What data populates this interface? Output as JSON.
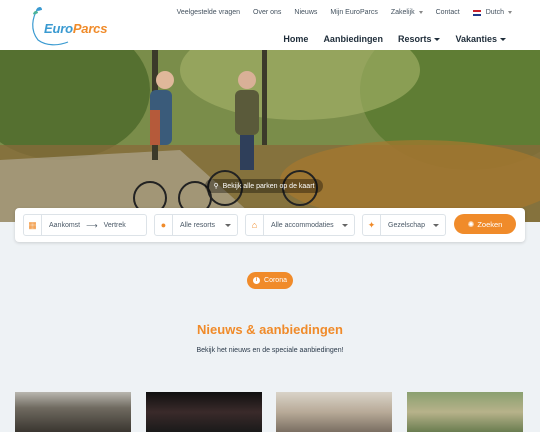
{
  "brand": {
    "logo_text_1": "Euro",
    "logo_text_2": "Parcs"
  },
  "topnav": {
    "items": [
      "Veelgestelde vragen",
      "Over ons",
      "Nieuws",
      "Mijn EuroParcs",
      "Zakelijk",
      "Contact"
    ],
    "language": "Dutch"
  },
  "mainnav": {
    "items": [
      "Home",
      "Aanbiedingen",
      "Resorts",
      "Vakanties"
    ]
  },
  "hero": {
    "map_link": "Bekijk alle parken op de kaart"
  },
  "search": {
    "arrival": "Aankomst",
    "departure": "Vertrek",
    "resorts": "Alle resorts",
    "accommodations": "Alle accommodaties",
    "company": "Gezelschap",
    "button": "Zoeken"
  },
  "corona": {
    "label": "Corona"
  },
  "news": {
    "title": "Nieuws & aanbiedingen",
    "subtitle": "Bekijk het nieuws en de speciale aanbiedingen!"
  },
  "colors": {
    "accent": "#f08b2a",
    "brand_blue": "#3a9ad1",
    "background": "#eef2f5"
  }
}
